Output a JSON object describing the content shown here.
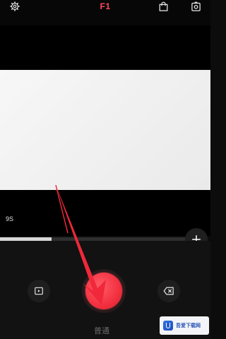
{
  "topbar": {
    "filter_label": "F1",
    "icons": [
      "gear-icon",
      "shopping-bag-icon",
      "camera-switch-icon"
    ]
  },
  "recorder": {
    "duration_label": "9S",
    "progress_fraction": 0.28,
    "mode_label": "普通"
  },
  "controls": {
    "icons": [
      "plus-icon",
      "play-square-icon",
      "backspace-icon"
    ]
  },
  "watermark": {
    "text": "吾爱下载网"
  },
  "colors": {
    "accent": "#f2303f",
    "filter_text": "#ff4a5c",
    "annotation": "#f0283a"
  }
}
